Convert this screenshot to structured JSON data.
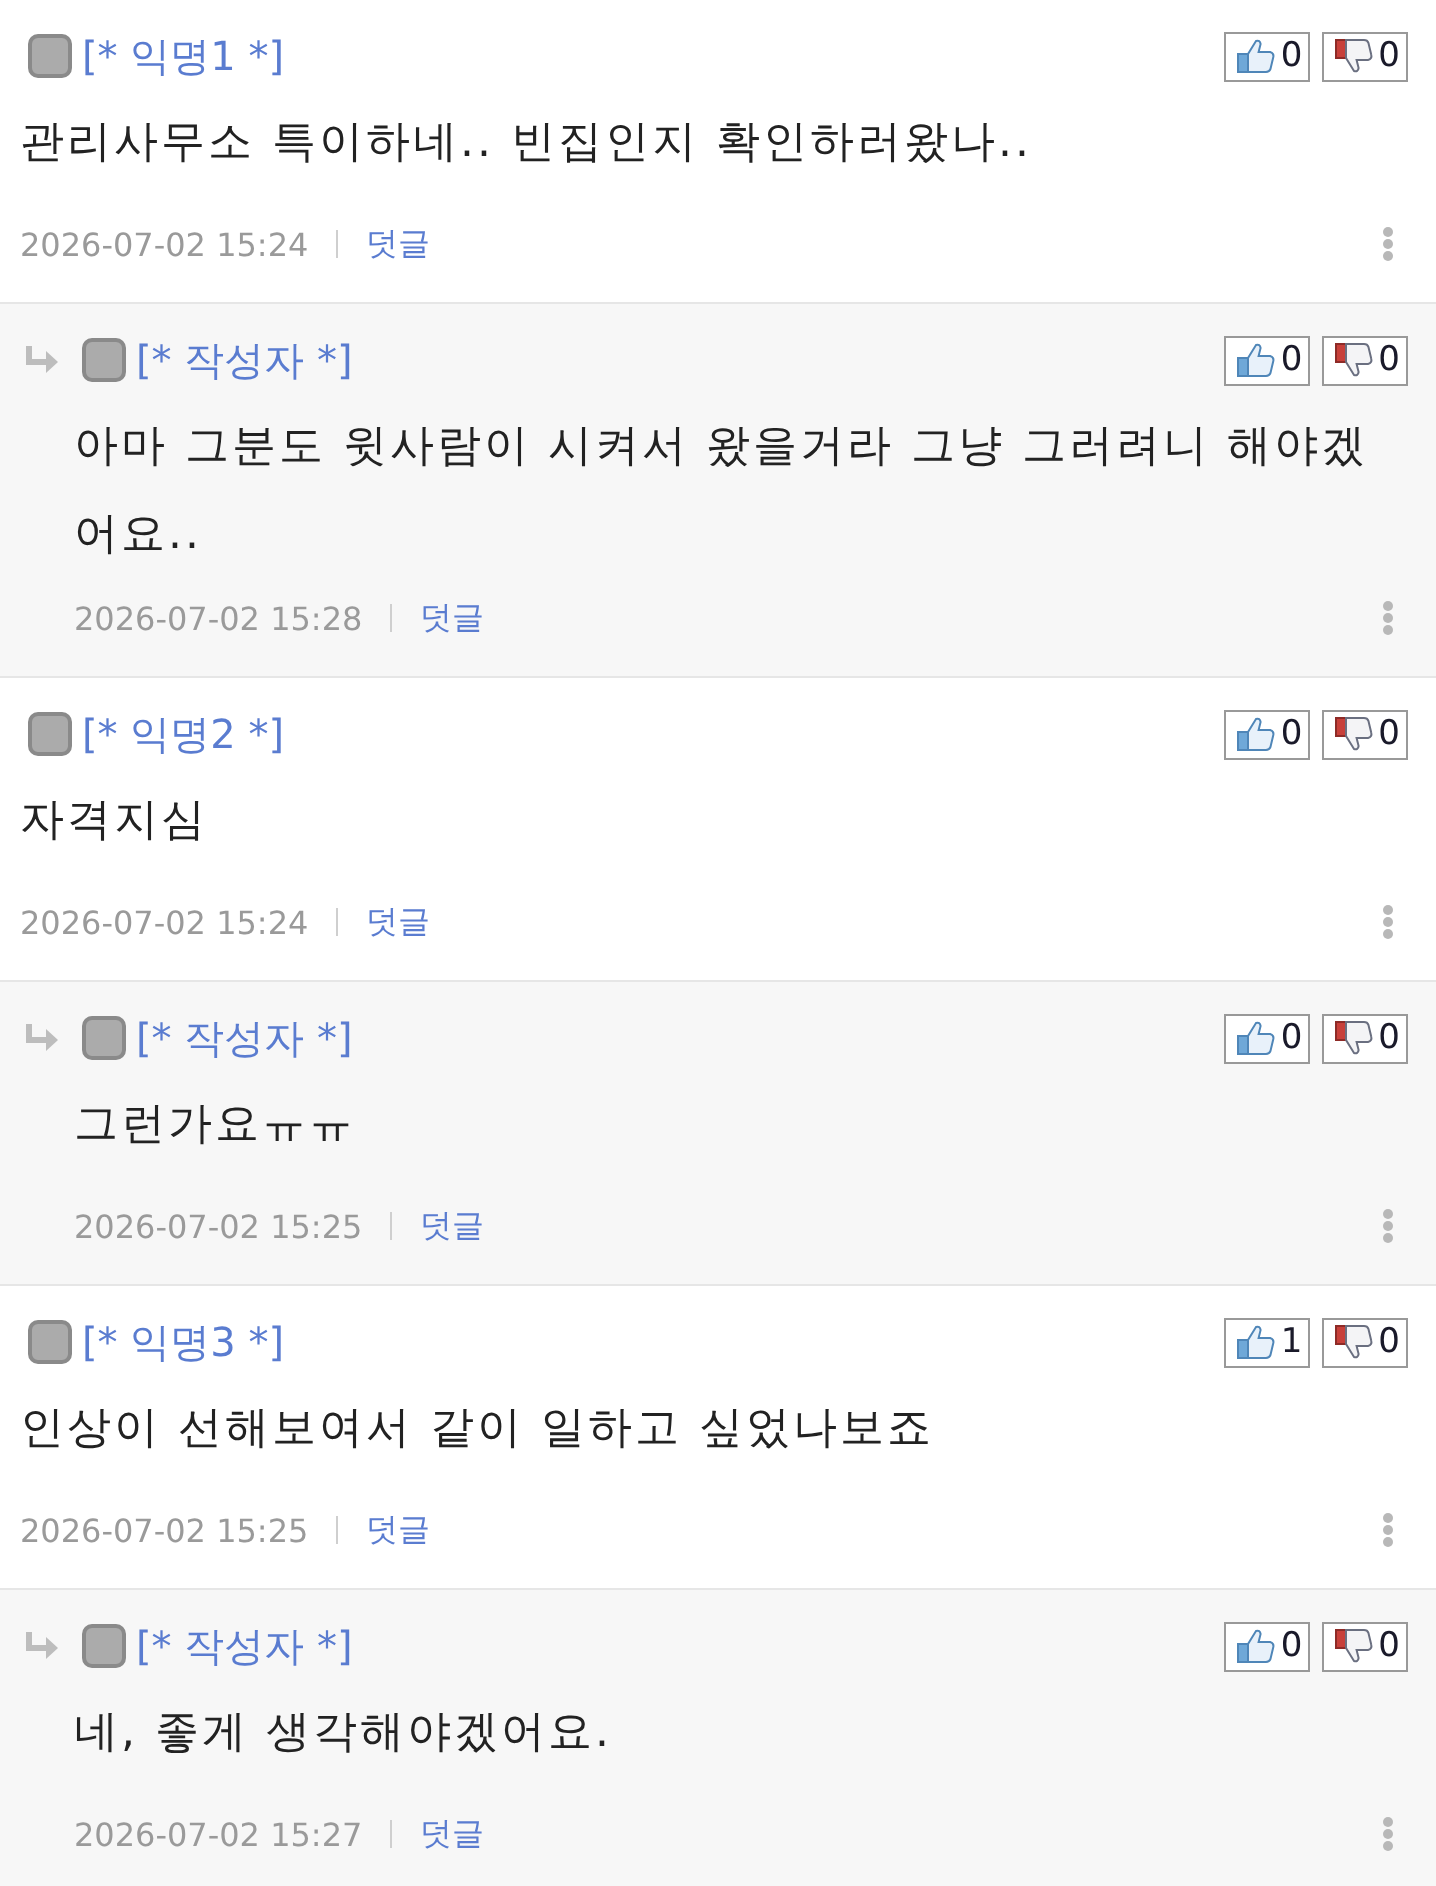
{
  "comments": [
    {
      "kind": "comment",
      "author": "[* 익명1 *]",
      "text": "관리사무소 특이하네.. 빈집인지 확인하러왔나..",
      "likes": "0",
      "dislikes": "0",
      "date": "2026-07-02 15:24",
      "reply_link": "덧글"
    },
    {
      "kind": "reply",
      "author": "[* 작성자 *]",
      "text": "아마 그분도 윗사람이 시켜서 왔을거라 그냥 그러려니 해야겠어요..",
      "likes": "0",
      "dislikes": "0",
      "date": "2026-07-02 15:28",
      "reply_link": "덧글"
    },
    {
      "kind": "comment",
      "author": "[* 익명2 *]",
      "text": "자격지심",
      "likes": "0",
      "dislikes": "0",
      "date": "2026-07-02 15:24",
      "reply_link": "덧글"
    },
    {
      "kind": "reply",
      "author": "[* 작성자 *]",
      "text": "그런가요ㅠㅠ",
      "likes": "0",
      "dislikes": "0",
      "date": "2026-07-02 15:25",
      "reply_link": "덧글"
    },
    {
      "kind": "comment",
      "author": "[* 익명3 *]",
      "text": "인상이 선해보여서 같이 일하고 싶었나보죠",
      "likes": "1",
      "dislikes": "0",
      "date": "2026-07-02 15:25",
      "reply_link": "덧글"
    },
    {
      "kind": "reply",
      "author": "[* 작성자 *]",
      "text": "네, 좋게 생각해야겠어요.",
      "likes": "0",
      "dislikes": "0",
      "date": "2026-07-02 15:27",
      "reply_link": "덧글"
    }
  ]
}
